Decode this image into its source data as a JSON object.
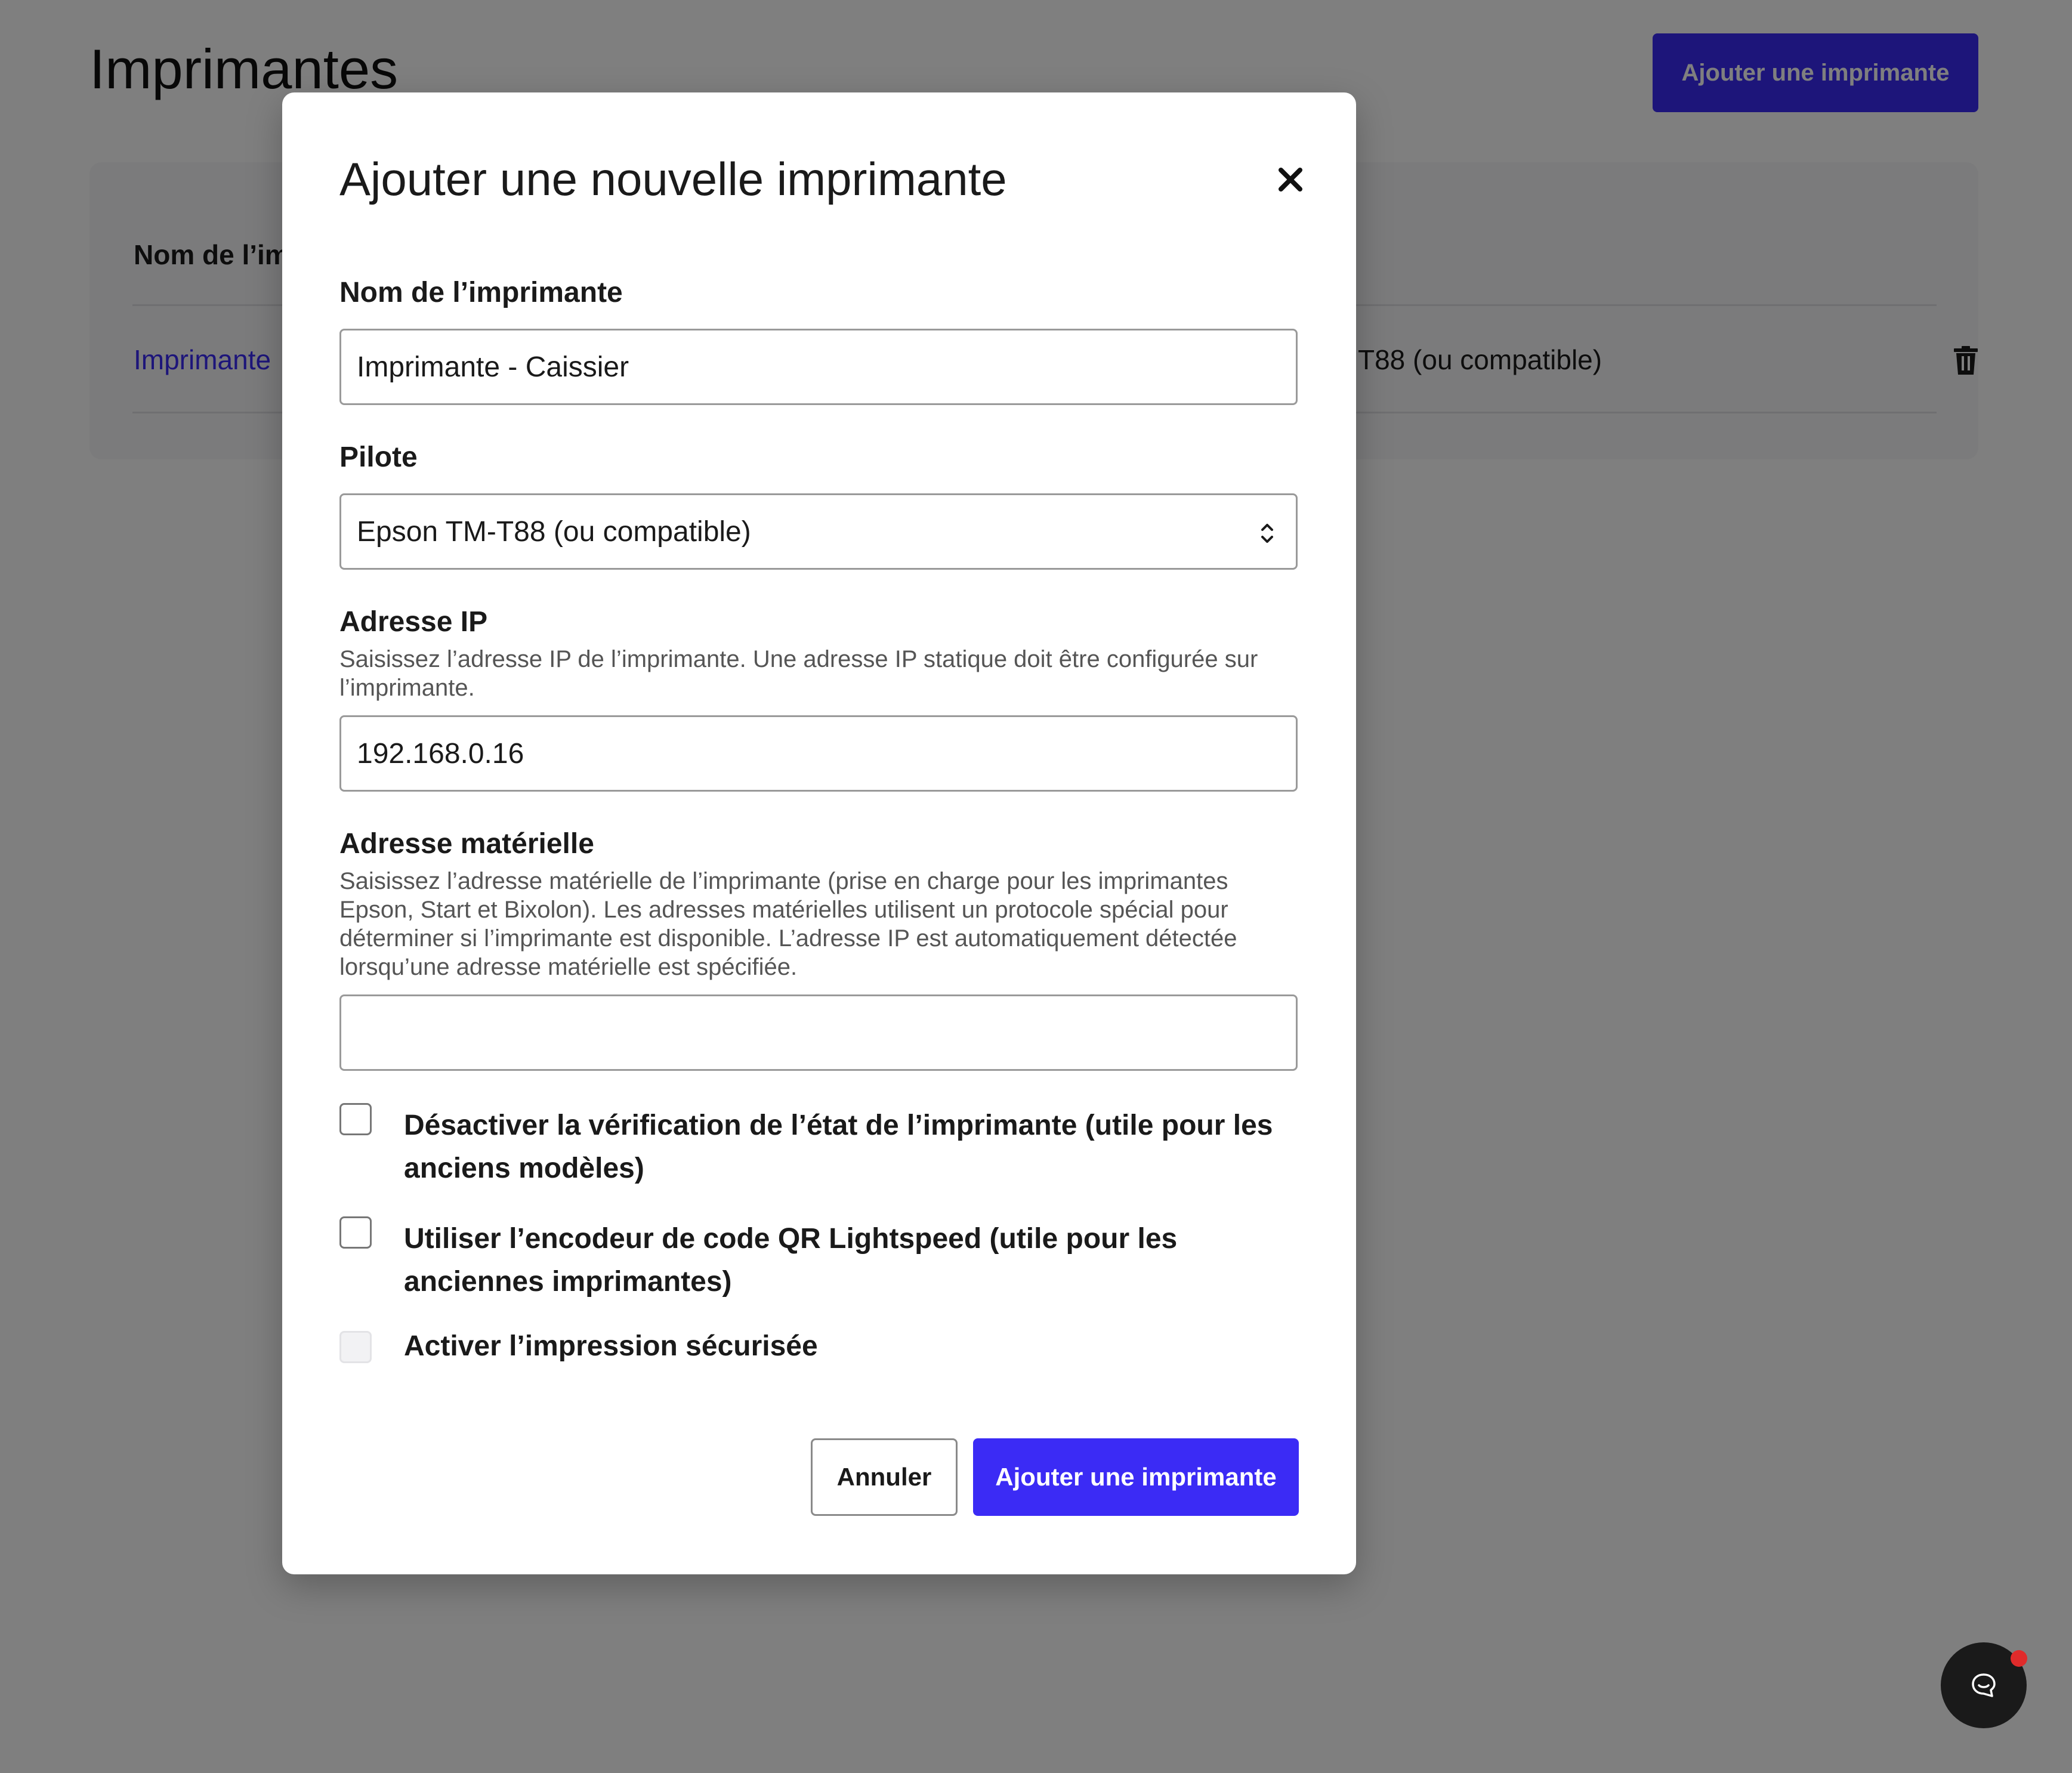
{
  "page": {
    "title": "Imprimantes",
    "add_button_label": "Ajouter une imprimante",
    "table": {
      "header_name": "Nom de l’im",
      "rows": [
        {
          "name": "Imprimante",
          "driver": "T88 (ou compatible)"
        }
      ]
    }
  },
  "modal": {
    "title": "Ajouter une nouvelle imprimante",
    "name_label": "Nom de l’imprimante",
    "name_value": "Imprimante - Caissier",
    "driver_label": "Pilote",
    "driver_value": "Epson TM-T88 (ou compatible)",
    "ip_label": "Adresse IP",
    "ip_help": "Saisissez l’adresse IP de l’imprimante. Une adresse IP statique doit être configurée sur l’imprimante.",
    "ip_value": "192.168.0.16",
    "mac_label": "Adresse matérielle",
    "mac_help": "Saisissez l’adresse matérielle de l’imprimante (prise en charge pour les imprimantes Epson, Start et Bixolon). Les adresses matérielles utilisent un protocole spécial pour déterminer si l’imprimante est disponible. L’adresse IP est automatiquement détectée lorsqu’une adresse matérielle est spécifiée.",
    "mac_value": "",
    "checkbox_status": "Désactiver la vérification de l’état de l’imprimante (utile pour les anciens modèles)",
    "checkbox_qr": "Utiliser l’encodeur de code QR Lightspeed (utile pour les anciennes imprimantes)",
    "checkbox_secure": "Activer l’impression sécurisée",
    "cancel_label": "Annuler",
    "submit_label": "Ajouter une imprimante"
  },
  "icons": {
    "close": "close-icon",
    "trash": "trash-icon",
    "chevron": "chevron-up-down-icon",
    "chat": "chat-icon"
  },
  "colors": {
    "accent": "#3b2bf5",
    "notification": "#e02b2b"
  }
}
